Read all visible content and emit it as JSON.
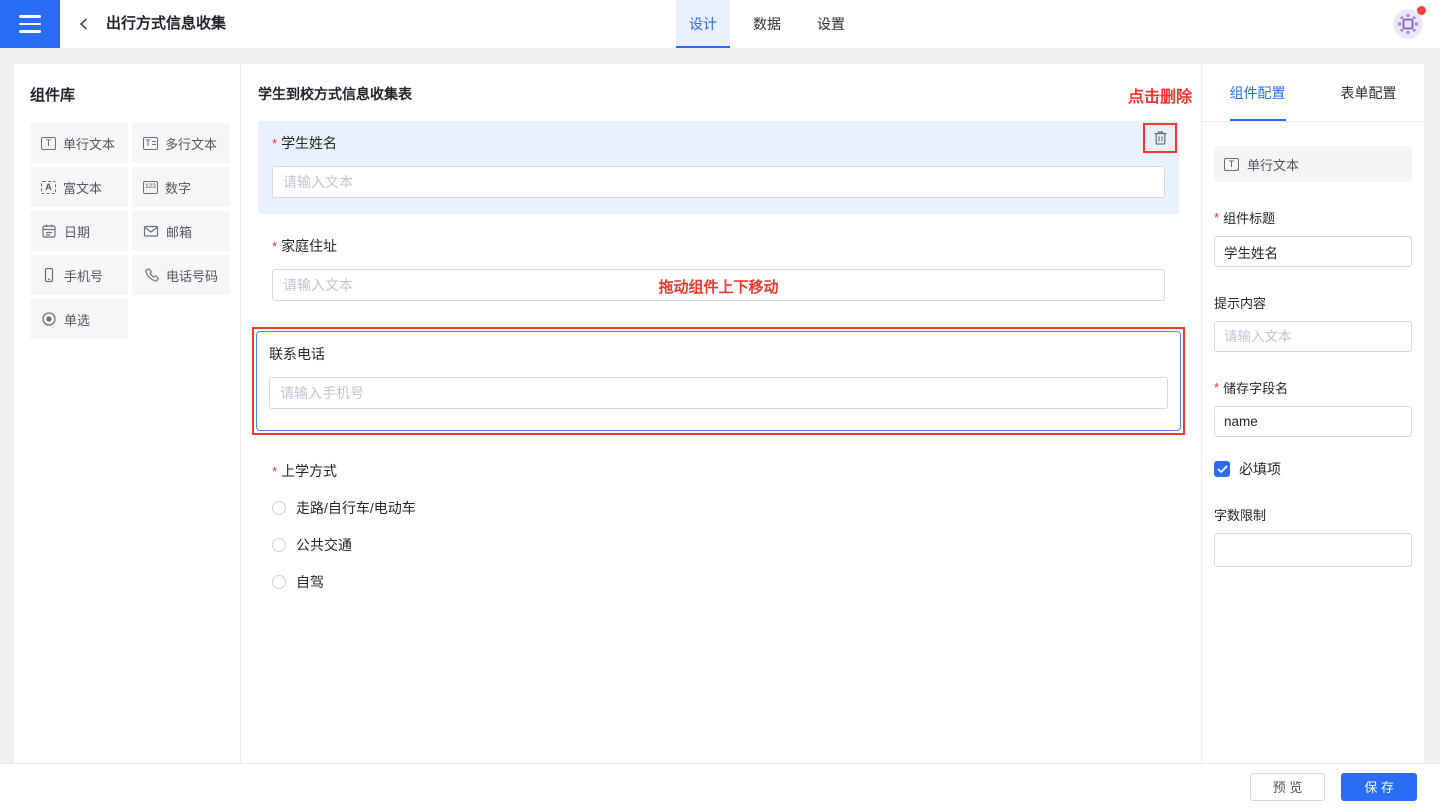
{
  "header": {
    "title": "出行方式信息收集",
    "tabs": [
      {
        "label": "设计",
        "active": true
      },
      {
        "label": "数据",
        "active": false
      },
      {
        "label": "设置",
        "active": false
      }
    ]
  },
  "library": {
    "title": "组件库",
    "items": [
      {
        "label": "单行文本",
        "icon": "single-line-text-icon"
      },
      {
        "label": "多行文本",
        "icon": "multi-line-text-icon"
      },
      {
        "label": "富文本",
        "icon": "rich-text-icon"
      },
      {
        "label": "数字",
        "icon": "number-icon"
      },
      {
        "label": "日期",
        "icon": "calendar-icon"
      },
      {
        "label": "邮箱",
        "icon": "envelope-icon"
      },
      {
        "label": "手机号",
        "icon": "mobile-phone-icon"
      },
      {
        "label": "电话号码",
        "icon": "telephone-icon"
      },
      {
        "label": "单选",
        "icon": "radio-icon"
      }
    ],
    "icon_glyphs": {
      "single_line": "T",
      "multi_line": "T",
      "rich": "A",
      "number": "123"
    }
  },
  "canvas": {
    "form_title": "学生到校方式信息收集表",
    "annotations": {
      "delete_hint": "点击删除",
      "drag_hint": "拖动组件上下移动"
    },
    "fields": [
      {
        "label": "学生姓名",
        "required": true,
        "placeholder": "请输入文本",
        "state": "selected"
      },
      {
        "label": "家庭住址",
        "required": true,
        "placeholder": "请输入文本",
        "state": "normal"
      },
      {
        "label": "联系电话",
        "required": false,
        "placeholder": "请输入手机号",
        "state": "dragging"
      },
      {
        "label": "上学方式",
        "required": true,
        "type": "radio",
        "options": [
          "走路/自行车/电动车",
          "公共交通",
          "自驾"
        ]
      }
    ]
  },
  "inspector": {
    "tabs": [
      {
        "label": "组件配置",
        "active": true
      },
      {
        "label": "表单配置",
        "active": false
      }
    ],
    "component_type": "单行文本",
    "fields": {
      "title_label": "组件标题",
      "title_value": "学生姓名",
      "hint_label": "提示内容",
      "hint_placeholder": "请输入文本",
      "field_name_label": "储存字段名",
      "field_name_value": "name",
      "required_label": "必填项",
      "required_checked": true,
      "limit_label": "字数限制",
      "limit_value": ""
    }
  },
  "footer": {
    "preview_label": "预 览",
    "save_label": "保 存"
  },
  "colors": {
    "primary": "#2b6cf6",
    "annotation_red": "#f0382e",
    "selected_field_bg": "#e8f1fd",
    "page_bg": "#eef0f2"
  }
}
